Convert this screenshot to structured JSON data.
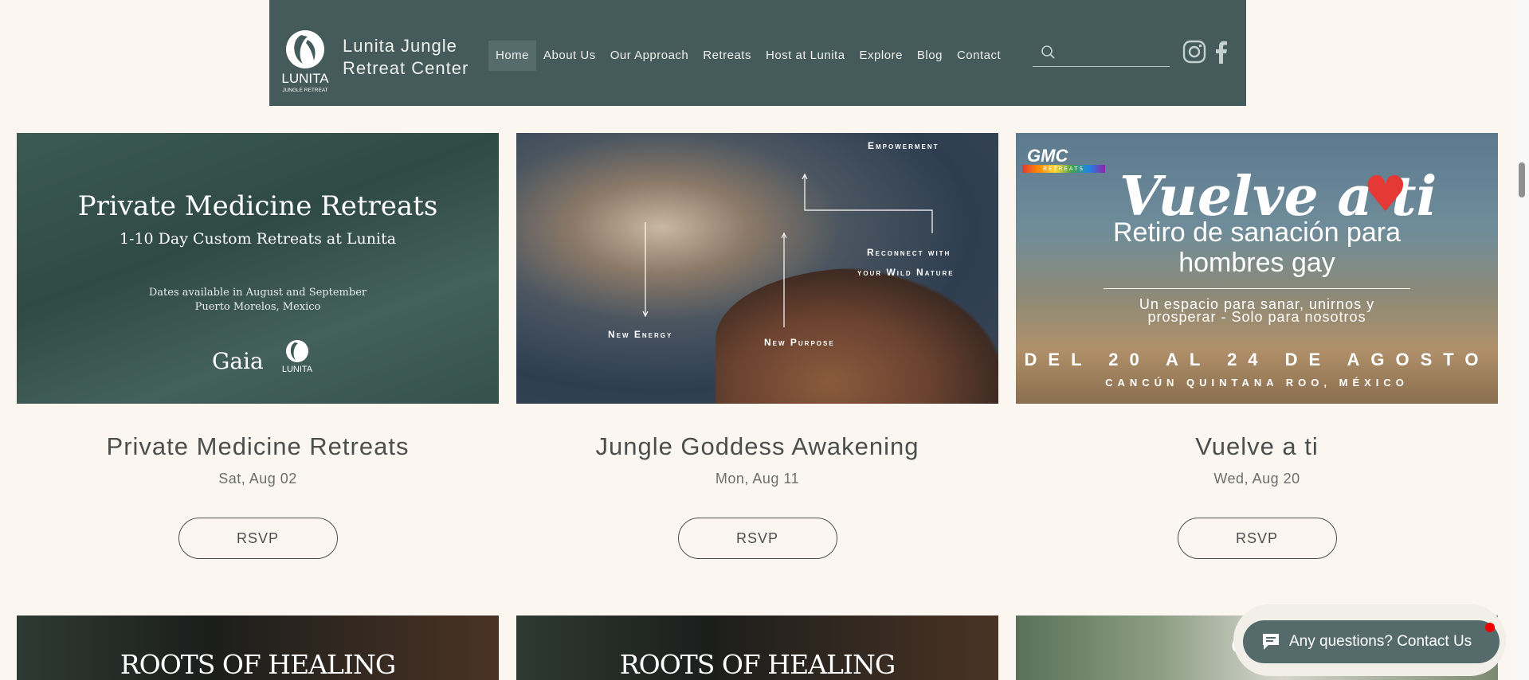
{
  "header": {
    "brand_line1": "Lunita Jungle",
    "brand_line2": "Retreat Center",
    "logo_text": "LUNITA",
    "logo_sub": "JUNGLE RETREAT",
    "nav": [
      "Home",
      "About Us",
      "Our Approach",
      "Retreats",
      "Host at Lunita",
      "Explore",
      "Blog",
      "Contact"
    ],
    "active_nav": "Home",
    "search": {
      "value": "",
      "icon": "search-icon"
    },
    "social": [
      "instagram-icon",
      "facebook-icon"
    ]
  },
  "events": [
    {
      "title": "Private Medicine Retreats",
      "date": "Sat, Aug 02",
      "rsvp": "RSVP",
      "image": {
        "heading": "Private Medicine Retreats",
        "subheading": "1-10 Day Custom Retreats at Lunita",
        "line1": "Dates available in August and September",
        "line2": "Puerto Morelos, Mexico",
        "partner": "Gaia",
        "logo_text": "LUNITA"
      }
    },
    {
      "title": "Jungle Goddess Awakening",
      "date": "Mon, Aug 11",
      "rsvp": "RSVP",
      "image": {
        "label_empowerment": "Empowerment",
        "label_reconnect1": "Reconnect with",
        "label_reconnect2": "your Wild Nature",
        "label_energy": "New Energy",
        "label_purpose": "New Purpose"
      }
    },
    {
      "title": "Vuelve a ti",
      "date": "Wed, Aug 20",
      "rsvp": "RSVP",
      "image": {
        "brand": "GMC",
        "brand_sub": "RETREATS",
        "headline": "Vuelve a ti",
        "sub1": "Retiro de sanación para",
        "sub2": "hombres gay",
        "tag1": "Un espacio para sanar, unirnos y",
        "tag2": "prosperar - Solo para nosotros",
        "dates": "DEL 20 AL 24 DE AGOSTO",
        "location": "CANCÚN QUINTANA ROO, MÉXICO"
      }
    }
  ],
  "bottom_row": [
    {
      "text": "ROOTS OF HEALING"
    },
    {
      "text": "ROOTS OF HEALING"
    },
    {
      "text": "G"
    }
  ],
  "chat": {
    "label": "Any questions? Contact Us"
  },
  "colors": {
    "header_bg": "#455b5b",
    "page_bg": "#fbf7f0",
    "chat_bg": "#556b6b"
  }
}
